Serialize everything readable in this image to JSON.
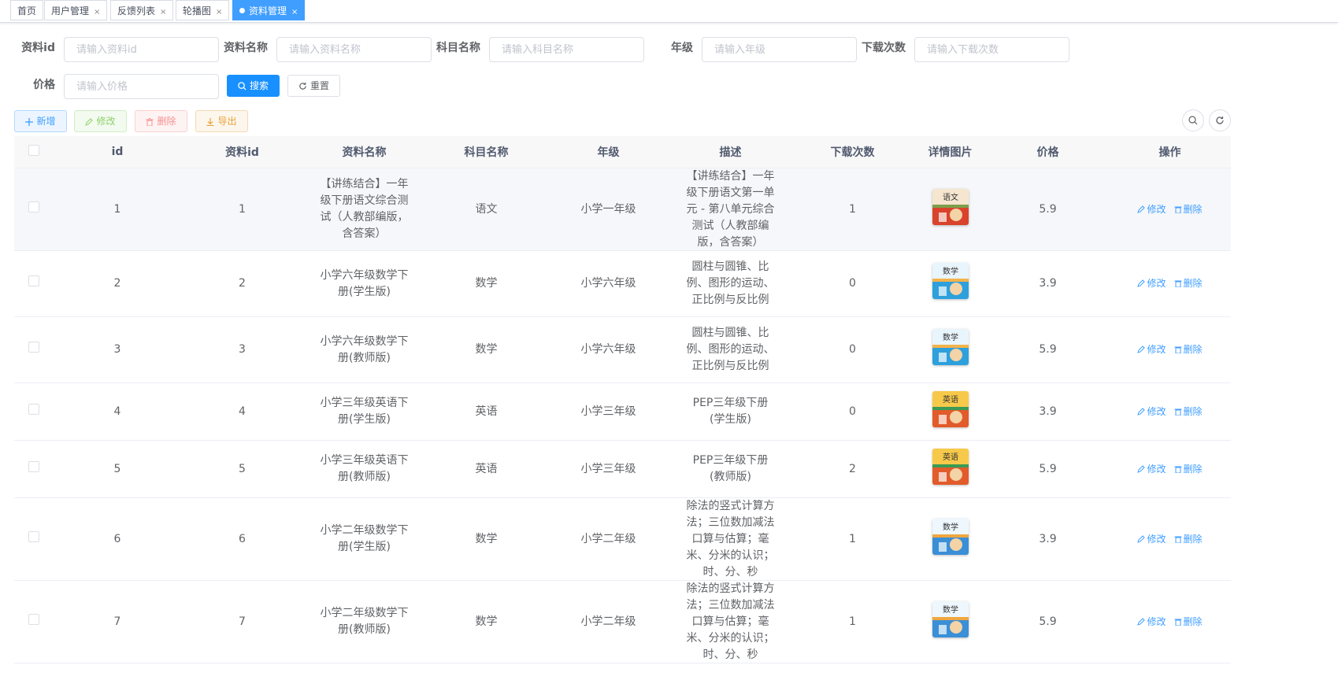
{
  "tags": [
    {
      "label": "首页",
      "closable": false
    },
    {
      "label": "用户管理",
      "closable": true
    },
    {
      "label": "反馈列表",
      "closable": true
    },
    {
      "label": "轮播图",
      "closable": true
    },
    {
      "label": "资料管理",
      "closable": true,
      "active": true
    }
  ],
  "close_glyph": "×",
  "search": {
    "fields": [
      {
        "label": "资料id",
        "placeholder": "请输入资料id"
      },
      {
        "label": "资料名称",
        "placeholder": "请输入资料名称"
      },
      {
        "label": "科目名称",
        "placeholder": "请输入科目名称"
      },
      {
        "label": "年级",
        "placeholder": "请输入年级"
      },
      {
        "label": "下载次数",
        "placeholder": "请输入下载次数"
      },
      {
        "label": "价格",
        "placeholder": "请输入价格"
      }
    ],
    "search_label": "搜索",
    "reset_label": "重置"
  },
  "toolbar": {
    "add_label": "新增",
    "edit_label": "修改",
    "delete_label": "删除",
    "export_label": "导出"
  },
  "table": {
    "columns": [
      "id",
      "资料id",
      "资料名称",
      "科目名称",
      "年级",
      "描述",
      "下载次数",
      "详情图片",
      "价格",
      "操作"
    ],
    "edit_label": "修改",
    "delete_label": "删除",
    "rows": [
      {
        "id": "1",
        "rid": "1",
        "name": "【讲练结合】一年级下册语文综合测试（人教部编版，含答案）",
        "subject": "语文",
        "grade": "小学一年级",
        "desc": "【讲练结合】一年级下册语文第一单元 - 第八单元综合测试（人教部编版，含答案）",
        "downloads": "1",
        "cover": "yuwen",
        "price": "5.9"
      },
      {
        "id": "2",
        "rid": "2",
        "name": "小学六年级数学下册(学生版)",
        "subject": "数学",
        "grade": "小学六年级",
        "desc": "圆柱与圆锥、比例、图形的运动、正比例与反比例",
        "downloads": "0",
        "cover": "math6",
        "price": "3.9"
      },
      {
        "id": "3",
        "rid": "3",
        "name": "小学六年级数学下册(教师版)",
        "subject": "数学",
        "grade": "小学六年级",
        "desc": "圆柱与圆锥、比例、图形的运动、正比例与反比例",
        "downloads": "0",
        "cover": "math6",
        "price": "5.9"
      },
      {
        "id": "4",
        "rid": "4",
        "name": "小学三年级英语下册(学生版)",
        "subject": "英语",
        "grade": "小学三年级",
        "desc": "PEP三年级下册 (学生版)",
        "downloads": "0",
        "cover": "english",
        "price": "3.9"
      },
      {
        "id": "5",
        "rid": "5",
        "name": "小学三年级英语下册(教师版)",
        "subject": "英语",
        "grade": "小学三年级",
        "desc": "PEP三年级下册 (教师版)",
        "downloads": "2",
        "cover": "english",
        "price": "5.9"
      },
      {
        "id": "6",
        "rid": "6",
        "name": "小学二年级数学下册(学生版)",
        "subject": "数学",
        "grade": "小学二年级",
        "desc": "除法的竖式计算方法；三位数加减法口算与估算；毫米、分米的认识；时、分、秒",
        "downloads": "1",
        "cover": "math2",
        "price": "3.9"
      },
      {
        "id": "7",
        "rid": "7",
        "name": "小学二年级数学下册(教师版)",
        "subject": "数学",
        "grade": "小学二年级",
        "desc": "除法的竖式计算方法；三位数加减法口算与估算；毫米、分米的认识；时、分、秒",
        "downloads": "1",
        "cover": "math2",
        "price": "5.9"
      }
    ]
  },
  "colors": {
    "primary": "#1890ff",
    "link": "#409eff",
    "header_bg": "#f8f8f9",
    "hover_row": "#f5f7fa"
  }
}
